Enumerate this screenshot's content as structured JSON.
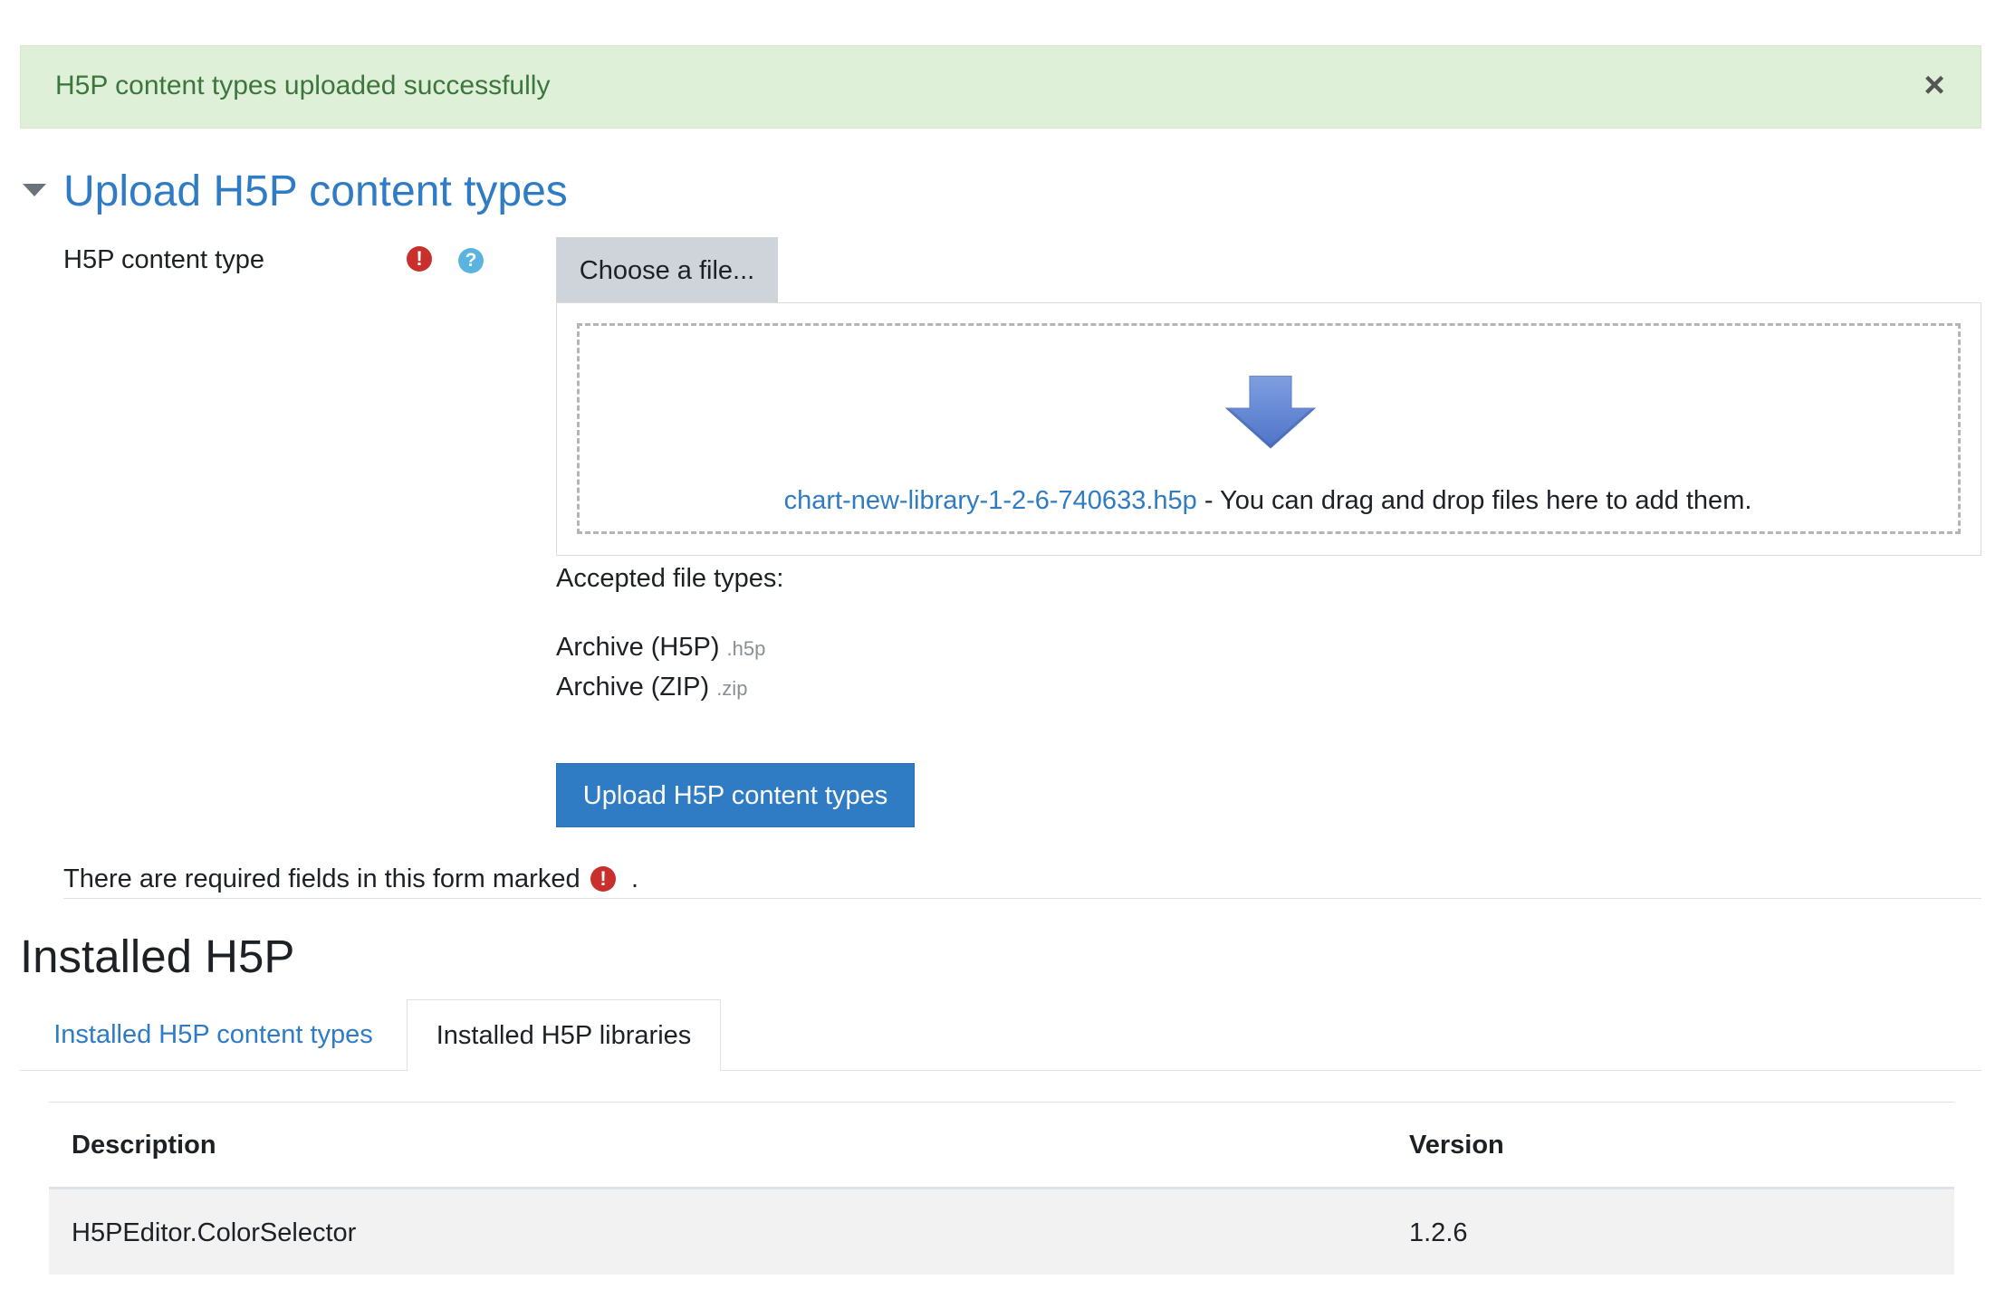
{
  "alert": {
    "message": "H5P content types uploaded successfully",
    "close_symbol": "×",
    "color": "#dff0d8"
  },
  "upload_section": {
    "title": "Upload H5P content types",
    "field_label": "H5P content type",
    "required_symbol": "!",
    "help_symbol": "?",
    "choose_button": "Choose a file...",
    "file_name": "chart-new-library-1-2-6-740633.h5p",
    "drop_hint": " - You can drag and drop files here to add them.",
    "accepted_title": "Accepted file types:",
    "file_types": [
      {
        "label": "Archive (H5P)",
        "ext": ".h5p"
      },
      {
        "label": "Archive (ZIP)",
        "ext": ".zip"
      }
    ],
    "submit_button": "Upload H5P content types",
    "required_note": "There are required fields in this form marked",
    "required_note_end": "."
  },
  "installed": {
    "title": "Installed H5P",
    "tabs": [
      {
        "label": "Installed H5P content types",
        "active": false
      },
      {
        "label": "Installed H5P libraries",
        "active": true
      }
    ],
    "table": {
      "headers": [
        "Description",
        "Version"
      ],
      "rows": [
        {
          "description": "H5PEditor.ColorSelector",
          "version": "1.2.6"
        }
      ]
    }
  },
  "colors": {
    "link": "#2f7bc4",
    "primary_button": "#2f7bc4",
    "required": "#c9302c",
    "help": "#5bb4e0"
  },
  "icons": {
    "close": "close-icon",
    "caret": "chevron-down-icon",
    "required": "required-icon",
    "help": "help-icon",
    "drop": "download-arrow-icon"
  }
}
